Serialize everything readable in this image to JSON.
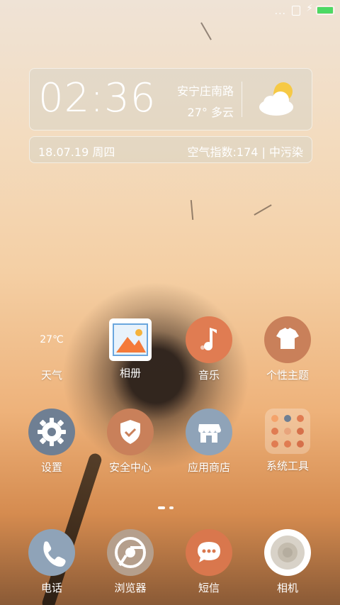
{
  "status_bar": {
    "more_dots": "..."
  },
  "weather_widget": {
    "time": "02:36",
    "location": "安宁庄南路",
    "temperature_condition": "27° 多云",
    "date": "18.07.19 周四",
    "air_quality": "空气指数:174 | 中污染"
  },
  "apps": [
    {
      "label": "天气",
      "mini": "27℃"
    },
    {
      "label": "相册"
    },
    {
      "label": "音乐"
    },
    {
      "label": "个性主题"
    },
    {
      "label": "设置"
    },
    {
      "label": "安全中心"
    },
    {
      "label": "应用商店"
    },
    {
      "label": "系统工具"
    }
  ],
  "dock": [
    {
      "label": "电话"
    },
    {
      "label": "浏览器"
    },
    {
      "label": "短信"
    },
    {
      "label": "相机"
    }
  ],
  "colors": {
    "music": "#e07c52",
    "theme": "#c9805a",
    "settings": "#6f7f93",
    "security": "#c9805a",
    "store": "#8fa3b8",
    "phone": "#8fa3b8",
    "browser": "#b59f8c",
    "sms": "#d9774d"
  }
}
